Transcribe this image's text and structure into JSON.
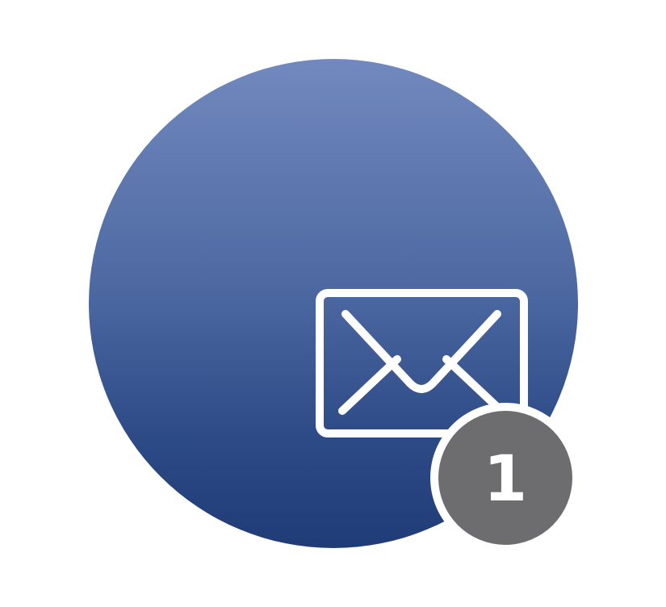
{
  "mail": {
    "icon": "envelope-icon",
    "colors": {
      "gradient_top": "#7189be",
      "gradient_bottom": "#203c77",
      "icon_stroke": "#ffffff"
    }
  },
  "badge": {
    "count": "1",
    "color": "#6d6d70"
  }
}
